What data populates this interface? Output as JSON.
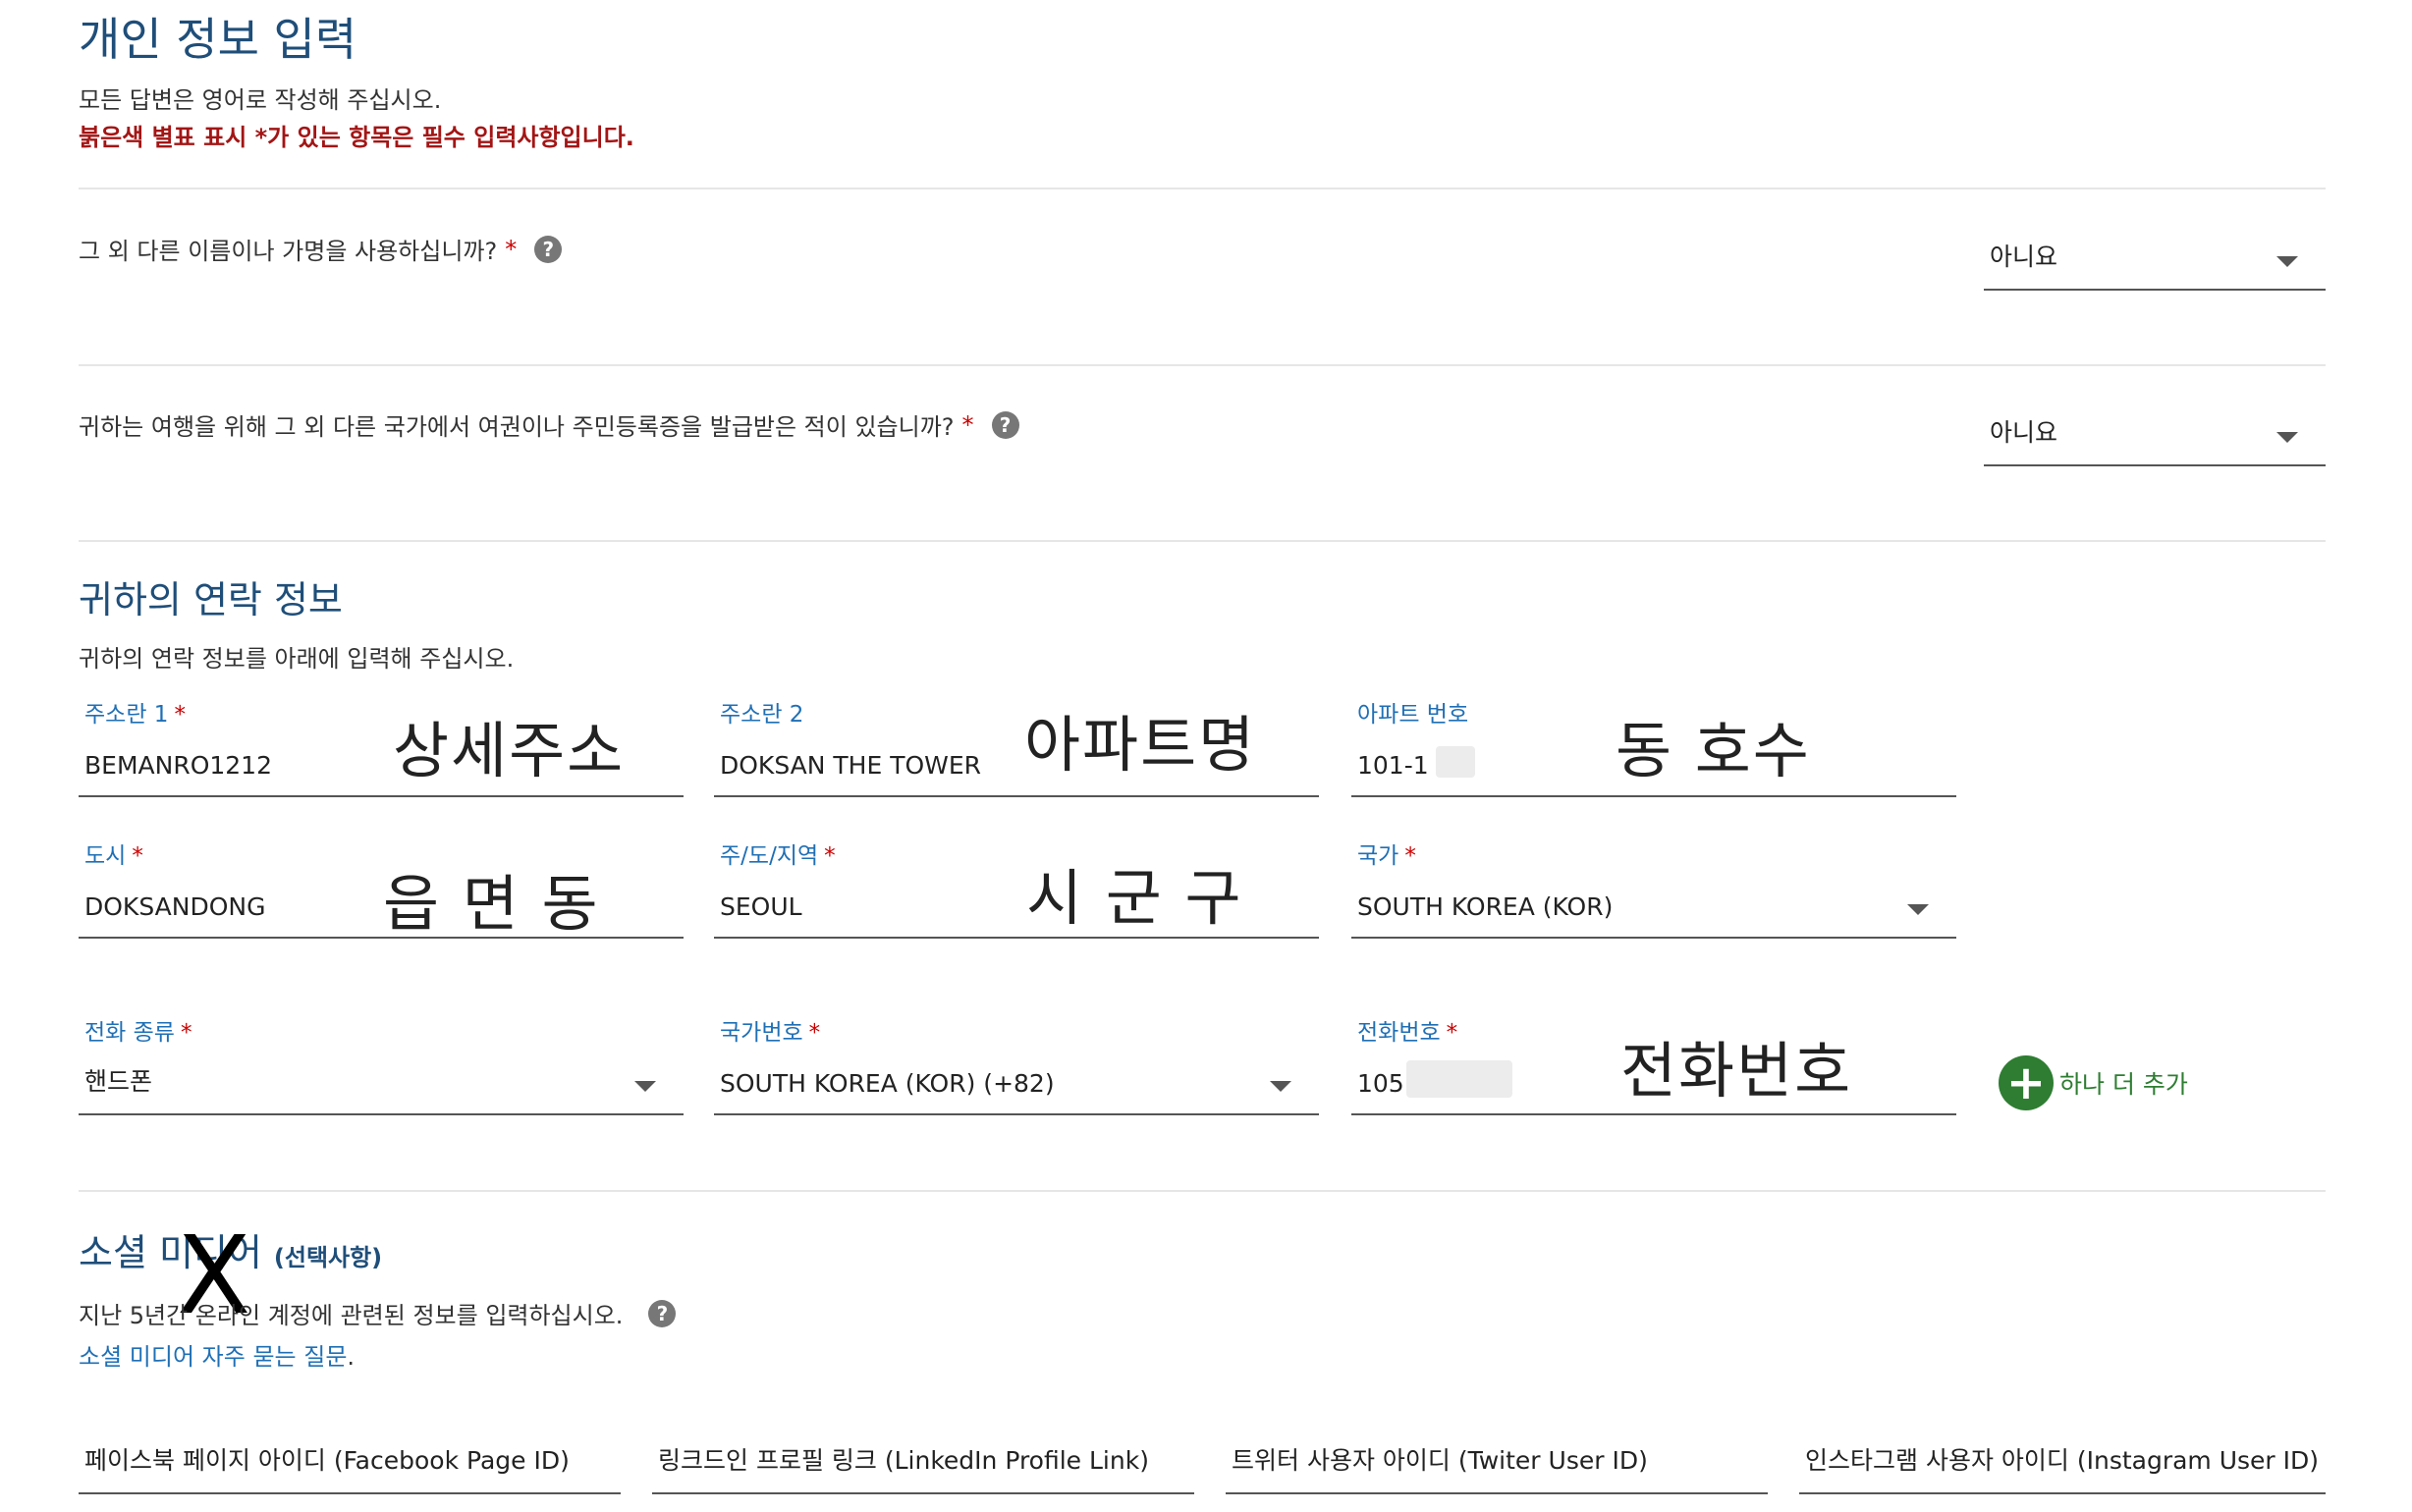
{
  "personal": {
    "title": "개인 정보 입력",
    "note": "모든 답변은 영어로 작성해 주십시오.",
    "required_note": "붉은색 별표 표시 *가 있는 항목은 필수 입력사항입니다.",
    "q1": {
      "text": "그 외 다른 이름이나 가명을 사용하십니까?",
      "star": "*",
      "answer": "아니요"
    },
    "q2": {
      "text": "귀하는 여행을 위해 그 외 다른 국가에서 여권이나 주민등록증을 발급받은 적이 있습니까?",
      "star": "*",
      "answer": "아니요"
    },
    "help_glyph": "?"
  },
  "contact": {
    "title": "귀하의 연락 정보",
    "note": "귀하의 연락 정보를 아래에 입력해 주십시오.",
    "address1": {
      "label": "주소란 1",
      "star": "*",
      "value": "BEMANRO1212",
      "annotation": "상세주소"
    },
    "address2": {
      "label": "주소란 2",
      "value": "DOKSAN THE TOWER",
      "annotation": "아파트명"
    },
    "apt": {
      "label": "아파트 번호",
      "value": "101-1",
      "annotation": "동 호수"
    },
    "city": {
      "label": "도시",
      "star": "*",
      "value": "DOKSANDONG",
      "annotation": "읍 면 동"
    },
    "state": {
      "label": "주/도/지역",
      "star": "*",
      "value": "SEOUL",
      "annotation": "시 군 구"
    },
    "country": {
      "label": "국가",
      "star": "*",
      "value": "SOUTH KOREA (KOR)"
    },
    "phone_type": {
      "label": "전화 종류",
      "star": "*",
      "value": "핸드폰"
    },
    "country_code": {
      "label": "국가번호",
      "star": "*",
      "value": "SOUTH KOREA (KOR) (+82)"
    },
    "phone": {
      "label": "전화번호",
      "star": "*",
      "value": "105",
      "annotation": "전화번호"
    },
    "add_more": {
      "glyph": "+",
      "label": "하나 더 추가"
    }
  },
  "social": {
    "title": "소셜 미디어",
    "optional": "(선택사항)",
    "overlay_mark": "X",
    "note": "지난 5년간 온라인 계정에 관련된 정보를 입력하십시오.",
    "faq_link": "소셜 미디어 자주 묻는 질문",
    "faq_period": ".",
    "fields": [
      "페이스북 페이지 아이디 (Facebook Page ID)",
      "링크드인 프로필 링크 (LinkedIn Profile Link)",
      "트위터 사용자 아이디 (Twiter User ID)",
      "인스타그램 사용자 아이디 (Instagram User ID)"
    ]
  }
}
